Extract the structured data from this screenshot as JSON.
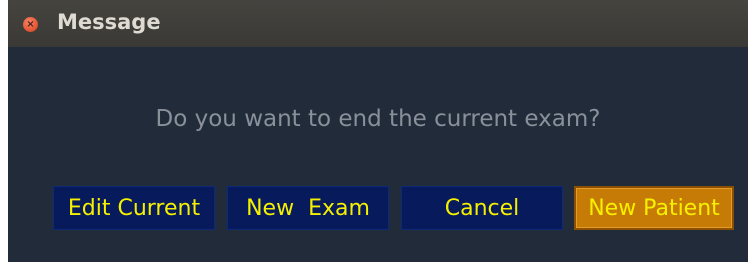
{
  "window": {
    "title": "Message",
    "close_glyph": "×"
  },
  "dialog": {
    "message": "Do you want to end the current exam?"
  },
  "buttons": {
    "edit_current": "Edit Current",
    "new_exam": "New  Exam",
    "cancel": "Cancel",
    "new_patient": "New Patient"
  },
  "colors": {
    "dialog_background": "#222b3a",
    "button_background": "#061a5c",
    "button_text": "#f5f000",
    "default_button_background": "#c77b07",
    "close_button": "#e1502d"
  }
}
